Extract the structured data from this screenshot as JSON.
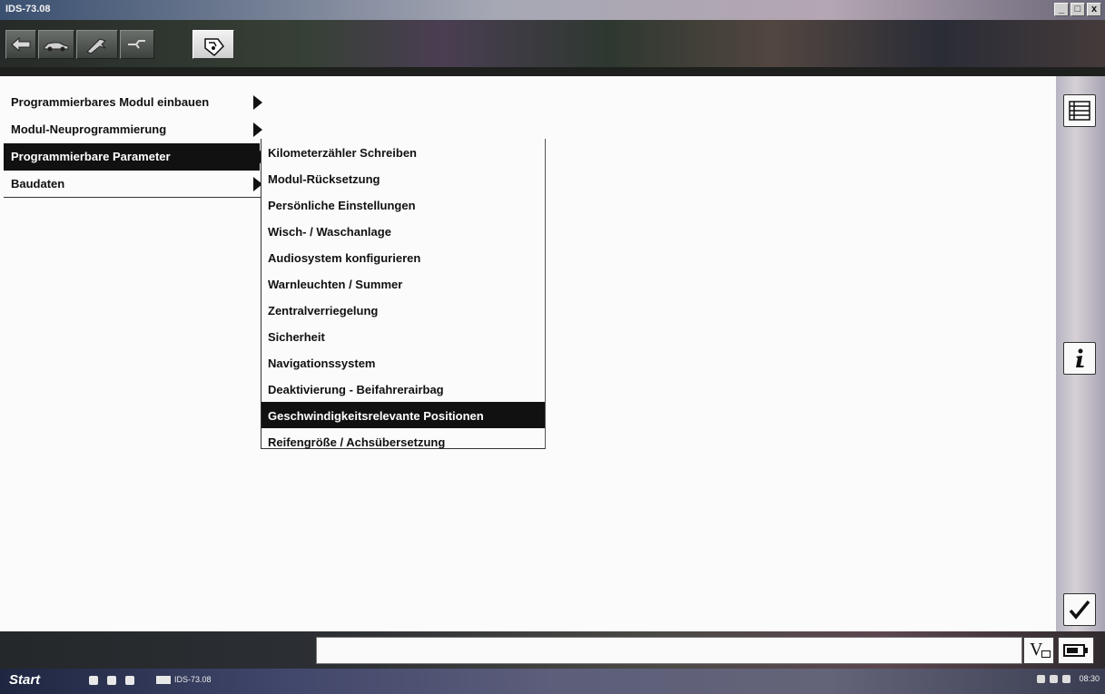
{
  "window": {
    "title": "IDS-73.08",
    "min_label": "_",
    "max_label": "□",
    "close_label": "x"
  },
  "toolbar": {
    "icons": [
      "back-arrow-icon",
      "vehicle-icon",
      "tools-icon",
      "wrench-icon",
      "module-programming-icon"
    ]
  },
  "menu": {
    "items": [
      {
        "label": "Programmierbares Modul einbauen"
      },
      {
        "label": "Modul-Neuprogrammierung"
      },
      {
        "label": "Programmierbare Parameter",
        "selected": true
      },
      {
        "label": "Baudaten"
      }
    ]
  },
  "submenu": {
    "items": [
      {
        "label": "Kilometerzähler Schreiben"
      },
      {
        "label": "Modul-Rücksetzung"
      },
      {
        "label": "Persönliche Einstellungen"
      },
      {
        "label": "Wisch- / Waschanlage"
      },
      {
        "label": "Audiosystem konfigurieren"
      },
      {
        "label": "Warnleuchten / Summer"
      },
      {
        "label": "Zentralverriegelung"
      },
      {
        "label": "Sicherheit"
      },
      {
        "label": "Navigationssystem"
      },
      {
        "label": "Deaktivierung - Beifahrerairbag"
      },
      {
        "label": "Geschwindigkeitsrelevante Positionen",
        "selected": true
      },
      {
        "label": "Reifengröße / Achsübersetzung"
      }
    ]
  },
  "sidebar": {
    "icons": [
      "list-icon",
      "info-icon",
      "checkmark-icon"
    ]
  },
  "bottom": {
    "command_value": "",
    "v_label": "V"
  },
  "taskbar": {
    "start_label": "Start",
    "task_label": "IDS-73.08",
    "clock": "08:30"
  }
}
